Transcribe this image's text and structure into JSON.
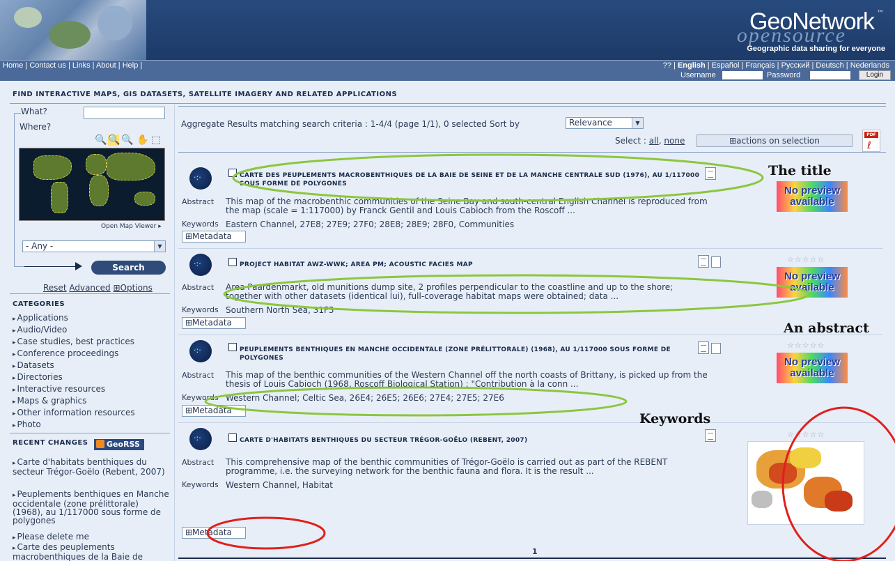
{
  "header": {
    "logo_word": "GeoNetwork",
    "logo_tm": "™",
    "logo_sub": "opensource",
    "tagline": "Geographic data sharing for everyone"
  },
  "nav": {
    "left_items": [
      "Home",
      "Contact us",
      "Links",
      "About",
      "Help"
    ],
    "languages": [
      "??",
      "English",
      "Español",
      "Français",
      "Русский",
      "Deutsch",
      "Nederlands"
    ],
    "username_label": "Username",
    "password_label": "Password",
    "login_label": "Login"
  },
  "search": {
    "heading": "FIND INTERACTIVE MAPS, GIS DATASETS, SATELLITE IMAGERY AND RELATED APPLICATIONS",
    "what_label": "What?",
    "where_label": "Where?",
    "open_map_viewer": "Open Map Viewer ▸",
    "region_selected": "- Any -",
    "search_button": "Search",
    "reset": "Reset",
    "advanced": "Advanced",
    "options": "⊞Options"
  },
  "categories": {
    "title": "CATEGORIES",
    "items": [
      "Applications",
      "Audio/Video",
      "Case studies, best practices",
      "Conference proceedings",
      "Datasets",
      "Directories",
      "Interactive resources",
      "Maps & graphics",
      "Other information resources",
      "Photo"
    ]
  },
  "recent": {
    "title": "RECENT CHANGES",
    "georss": "GeoRSS",
    "items": [
      "Carte d'habitats benthiques du secteur Trégor-Goëlo (Rebent, 2007)",
      "Peuplements benthiques en Manche occidentale (zone prélittorale) (1968), au 1/117000 sous forme de polygones",
      "Please delete me",
      "Carte des peuplements macrobenthiques de la Baie de"
    ]
  },
  "results": {
    "summary": "Aggregate Results matching search criteria :  1-4/4  (page 1/1),  0 selected  Sort by",
    "sort_value": "Relevance",
    "select_label": "Select :",
    "select_all": "all",
    "select_none": "none",
    "actions_label": "⊞actions on selection",
    "abstract_label": "Abstract",
    "keywords_label": "Keywords",
    "metadata_label": "⊞Metadata",
    "no_preview_line1": "No preview",
    "no_preview_line2": "available",
    "stars": "☆☆☆☆☆",
    "page": "1",
    "records": [
      {
        "title": "CARTE DES PEUPLEMENTS MACROBENTHIQUES DE LA BAIE DE SEINE ET DE LA MANCHE CENTRALE SUD (1976), AU 1/117000 SOUS FORME DE POLYGONES",
        "abstract_l1": "This map of the macrobenthic communities of the Seine Bay and south-central English Channel is reproduced from",
        "abstract_l2": "the map (scale = 1:117000) by Franck Gentil and Louis Cabioch from the Roscoff ...",
        "keywords": "Eastern Channel, 27E8; 27E9; 27F0; 28E8; 28E9; 28F0, Communities"
      },
      {
        "title": "PROJECT HABITAT AWZ-WWK; AREA PM; ACOUSTIC FACIES MAP",
        "abstract_l1": "Area Paardenmarkt, old munitions dump site, 2 profiles perpendicular to the coastline and up to the shore;",
        "abstract_l2": "together with other datasets (identical lui), full-coverage habitat maps were obtained; data ...",
        "keywords": "Southern North Sea, 31F3"
      },
      {
        "title": "PEUPLEMENTS BENTHIQUES EN MANCHE OCCIDENTALE (ZONE PRÉLITTORALE) (1968), AU 1/117000 SOUS FORME DE POLYGONES",
        "abstract_l1": "This map of the benthic communities of the Western Channel off the north coasts of Brittany, is picked up from the",
        "abstract_l2": "thesis of Louis Cabioch (1968, Roscoff Biological Station) : \"Contribution à la conn ...",
        "keywords": "Western Channel; Celtic Sea, 26E4; 26E5; 26E6; 27E4; 27E5; 27E6"
      },
      {
        "title": "CARTE D'HABITATS BENTHIQUES DU SECTEUR TRÉGOR-GOËLO (REBENT, 2007)",
        "abstract_l1": "This comprehensive map of the benthic communities of Trégor-Goëlo is carried out as part of the REBENT",
        "abstract_l2": "programme, i.e. the surveying network for the benthic fauna and flora. It is the result ...",
        "keywords": "Western Channel, Habitat"
      }
    ]
  },
  "annotations": {
    "title": "The title",
    "abstract": "An abstract",
    "keywords": "Keywords"
  },
  "colors": {
    "header_blue": "#274a7d",
    "panel_bg": "#e7eef7",
    "ellipse_green": "#8cc63f",
    "ellipse_red": "#e0201c"
  }
}
